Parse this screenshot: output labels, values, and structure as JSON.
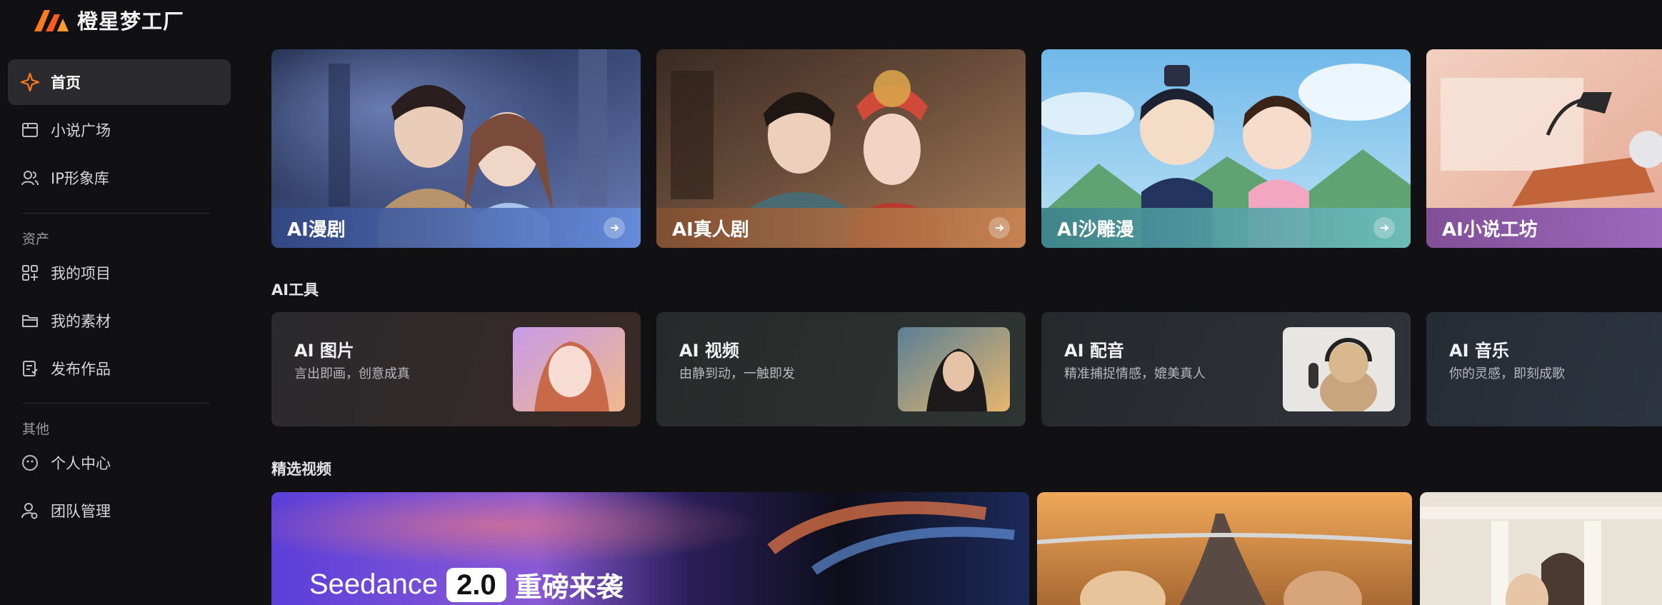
{
  "app": {
    "name": "橙星梦工厂",
    "brand_color": "#ff6a1a"
  },
  "sidebar": {
    "items": [
      {
        "label": "首页",
        "icon": "sparkle-icon",
        "active": true
      },
      {
        "label": "小说广场",
        "icon": "book-icon"
      },
      {
        "label": "IP形象库",
        "icon": "users-icon"
      }
    ],
    "assets_label": "资产",
    "assets_items": [
      {
        "label": "我的项目",
        "icon": "grid-icon"
      },
      {
        "label": "我的素材",
        "icon": "folder-icon"
      },
      {
        "label": "发布作品",
        "icon": "publish-icon"
      }
    ],
    "other_label": "其他",
    "other_items": [
      {
        "label": "个人中心",
        "icon": "face-icon"
      },
      {
        "label": "团队管理",
        "icon": "team-icon"
      }
    ]
  },
  "hero_cards": [
    {
      "title": "AI漫剧",
      "color": "#4a66b8"
    },
    {
      "title": "AI真人剧",
      "color": "#c07a48"
    },
    {
      "title": "AI沙雕漫",
      "color": "#4aa0a8"
    },
    {
      "title": "AI小说工坊",
      "color": "#7a4f9c"
    }
  ],
  "tools_section_title": "AI工具",
  "tools": [
    {
      "name": "AI 图片",
      "desc": "言出即画，创意成真"
    },
    {
      "name": "AI 视频",
      "desc": "由静到动，一触即发"
    },
    {
      "name": "AI 配音",
      "desc": "精准捕捉情感，媲美真人"
    },
    {
      "name": "AI 音乐",
      "desc": "你的灵感，即刻成歌"
    }
  ],
  "videos_section_title": "精选视频",
  "featured": {
    "word": "Seedance",
    "version": "2.0",
    "tagline": "重磅来袭"
  }
}
